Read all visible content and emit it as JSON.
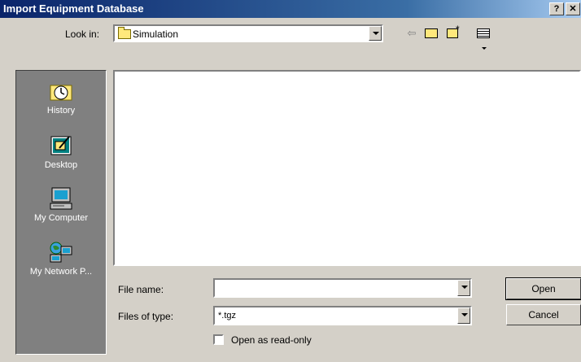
{
  "window": {
    "title": "Import Equipment Database",
    "help_label": "?",
    "close_label": "✕"
  },
  "toolbar": {
    "lookin_label": "Look in:",
    "lookin_value": "Simulation",
    "back_icon": "back-arrow-icon",
    "up_icon": "up-folder-icon",
    "new_folder_icon": "new-folder-icon",
    "view_menu_icon": "view-menu-icon"
  },
  "places": [
    {
      "label": "History",
      "icon": "history-icon"
    },
    {
      "label": "Desktop",
      "icon": "desktop-icon"
    },
    {
      "label": "My Computer",
      "icon": "computer-icon"
    },
    {
      "label": "My Network P...",
      "icon": "network-icon"
    }
  ],
  "form": {
    "filename_label": "File name:",
    "filename_value": "",
    "filetype_label": "Files of type:",
    "filetype_value": "*.tgz",
    "readonly_label": "Open as read-only",
    "readonly_checked": false
  },
  "buttons": {
    "open": "Open",
    "cancel": "Cancel"
  },
  "colors": {
    "title_start": "#0a246a",
    "title_end": "#a6caf0",
    "face": "#d4d0c8",
    "places_bg": "#808080"
  }
}
